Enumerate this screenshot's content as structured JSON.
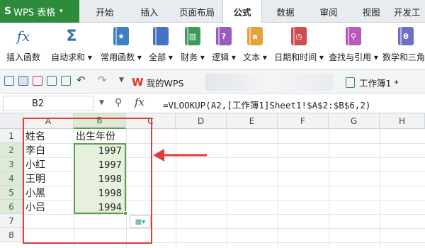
{
  "app_button": {
    "logo": "S",
    "label": "WPS 表格",
    "caret": "▾"
  },
  "tabs": [
    {
      "label": "开始",
      "active": false
    },
    {
      "label": "插入",
      "active": false
    },
    {
      "label": "页面布局",
      "active": false
    },
    {
      "label": "公式",
      "active": true
    },
    {
      "label": "数据",
      "active": false
    },
    {
      "label": "审阅",
      "active": false
    },
    {
      "label": "视图",
      "active": false
    },
    {
      "label": "开发工",
      "active": false
    }
  ],
  "ribbon": [
    {
      "label": "插入函数",
      "icon": "fx-icon",
      "glyph": "fx",
      "color": "#3b6fb6"
    },
    {
      "label": "自动求和 ▾",
      "icon": "sigma-icon",
      "glyph": "Σ",
      "color": "#2f6fb7"
    },
    {
      "label": "常用函数 ▾",
      "icon": "star-book-icon",
      "glyph": "★",
      "color": "#3f7ec4"
    },
    {
      "label": "全部 ▾",
      "icon": "book-blue-icon",
      "glyph": "",
      "color": "#4472c4"
    },
    {
      "label": "财务 ▾",
      "icon": "finance-book-icon",
      "glyph": "▥",
      "color": "#3e9a5a"
    },
    {
      "label": "逻辑 ▾",
      "icon": "logic-book-icon",
      "glyph": "?",
      "color": "#9a5bc0"
    },
    {
      "label": "文本 ▾",
      "icon": "text-book-icon",
      "glyph": "a",
      "color": "#e9a23b"
    },
    {
      "label": "日期和时间 ▾",
      "icon": "clock-book-icon",
      "glyph": "◷",
      "color": "#d04d4d"
    },
    {
      "label": "查找与引用 ▾",
      "icon": "search-book-icon",
      "glyph": "⚲",
      "color": "#b65bb8"
    },
    {
      "label": "数学和三角",
      "icon": "math-book-icon",
      "glyph": "θ",
      "color": "#6c6fc7"
    }
  ],
  "doc_tabs": {
    "wps_logo": "W",
    "my_wps": "我的WPS",
    "workbook": "工作簿1 *"
  },
  "formula_bar": {
    "cell_ref": "B2",
    "fx": "fx",
    "formula": "=VLOOKUP(A2,[工作簿1]Sheet1!$A$2:$B$6,2)"
  },
  "columns": [
    "A",
    "B",
    "C",
    "D",
    "E",
    "F",
    "G",
    "H"
  ],
  "rows": [
    "1",
    "2",
    "3",
    "4",
    "5",
    "6",
    "7",
    "8"
  ],
  "sheet": {
    "header": {
      "name": "姓名",
      "year": "出生年份"
    },
    "records": [
      {
        "name": "李白",
        "year": "1997"
      },
      {
        "name": "小红",
        "year": "1997"
      },
      {
        "name": "王明",
        "year": "1998"
      },
      {
        "name": "小黑",
        "year": "1998"
      },
      {
        "name": "小吕",
        "year": "1994"
      }
    ]
  },
  "colors": {
    "accent_green": "#2d8b3c",
    "selection_border": "#5aa24a",
    "annotation_red": "#e23b3b"
  }
}
